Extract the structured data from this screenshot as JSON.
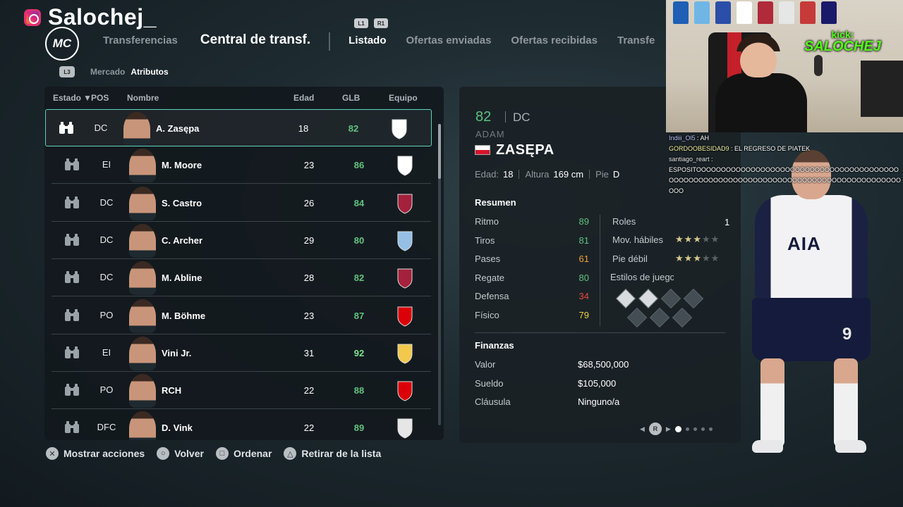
{
  "brand": {
    "name": "Salochej_"
  },
  "logo": {
    "text": "MC"
  },
  "nav": {
    "section": "Transferencias",
    "title": "Central de transf.",
    "bumper_left": "L1",
    "bumper_right": "R1",
    "tabs": [
      "Listado",
      "Ofertas enviadas",
      "Ofertas recibidas",
      "Transfe"
    ],
    "active_tab": "Listado"
  },
  "subnav": {
    "l3": "L3",
    "items": [
      "Mercado",
      "Atributos"
    ],
    "active": "Atributos"
  },
  "columns": {
    "estado": "Estado",
    "pos": "POS",
    "nombre": "Nombre",
    "edad": "Edad",
    "glb": "GLB",
    "equipo": "Equipo"
  },
  "players": [
    {
      "pos": "DC",
      "name": "A. Zasępa",
      "age": "18",
      "ovr": "82",
      "club": "Tottenham",
      "ovr_color": "#5fc27e",
      "club_color": "#ffffff"
    },
    {
      "pos": "EI",
      "name": "M. Moore",
      "age": "23",
      "ovr": "86",
      "club": "Tottenham",
      "ovr_color": "#5fc27e",
      "club_color": "#ffffff"
    },
    {
      "pos": "DC",
      "name": "S. Castro",
      "age": "26",
      "ovr": "84",
      "club": "Bologna",
      "ovr_color": "#5fc27e",
      "club_color": "#a3213b"
    },
    {
      "pos": "DC",
      "name": "C. Archer",
      "age": "29",
      "ovr": "80",
      "club": "Aston Villa",
      "ovr_color": "#5fc27e",
      "club_color": "#95bfe5"
    },
    {
      "pos": "DC",
      "name": "M. Abline",
      "age": "28",
      "ovr": "82",
      "club": "Bologna",
      "ovr_color": "#5fc27e",
      "club_color": "#a3213b"
    },
    {
      "pos": "PO",
      "name": "M. Böhme",
      "age": "23",
      "ovr": "87",
      "club": "Arsenal",
      "ovr_color": "#5fc27e",
      "club_color": "#db0007"
    },
    {
      "pos": "EI",
      "name": "Vini Jr.",
      "age": "31",
      "ovr": "92",
      "club": "Real Madrid",
      "ovr_color": "#7be58f",
      "club_color": "#f2c94c"
    },
    {
      "pos": "PO",
      "name": "RCH",
      "age": "22",
      "ovr": "88",
      "club": "Arsenal",
      "ovr_color": "#5fc27e",
      "club_color": "#db0007"
    },
    {
      "pos": "DFC",
      "name": "D. Vink",
      "age": "22",
      "ovr": "89",
      "club": "Newcastle",
      "ovr_color": "#5fc27e",
      "club_color": "#e6e6e6"
    }
  ],
  "actions": [
    {
      "btn": "✕",
      "label": "Mostrar acciones"
    },
    {
      "btn": "○",
      "label": "Volver"
    },
    {
      "btn": "□",
      "label": "Ordenar"
    },
    {
      "btn": "△",
      "label": "Retirar de la lista"
    }
  ],
  "detail": {
    "ovr": "82",
    "pos": "DC",
    "first_name": "ADAM",
    "last_name": "ZASĘPA",
    "age_label": "Edad:",
    "age": "18",
    "height_label": "Altura",
    "height": "169 cm",
    "foot_label": "Pie",
    "foot": "D",
    "summary_title": "Resumen",
    "stats": [
      {
        "label": "Ritmo",
        "value": "89",
        "color": "#5fc27e"
      },
      {
        "label": "Tiros",
        "value": "81",
        "color": "#5fc27e"
      },
      {
        "label": "Pases",
        "value": "61",
        "color": "#f0a233"
      },
      {
        "label": "Regate",
        "value": "80",
        "color": "#5fc27e"
      },
      {
        "label": "Defensa",
        "value": "34",
        "color": "#e5483d"
      },
      {
        "label": "Físico",
        "value": "79",
        "color": "#f0d23a"
      }
    ],
    "roles_label": "Roles",
    "roles_value": "1",
    "skill_moves_label": "Mov. hábiles",
    "skill_moves_stars": 3,
    "weak_foot_label": "Pie débil",
    "weak_foot_stars": 3,
    "playstyles_label": "Estilos de juego",
    "finance_title": "Finanzas",
    "value_label": "Valor",
    "value": "$68,500,000",
    "wage_label": "Sueldo",
    "wage": "$105,000",
    "clause_label": "Cláusula",
    "clause": "Ninguno/a",
    "pager_btn": "R",
    "colors": {
      "accent": "#5fd4bf"
    }
  },
  "stream": {
    "kick_small": "kick:",
    "kick_big": "SALOCHEJ",
    "chat": [
      {
        "user": "Indiii_Ol5",
        "msg": "AH"
      },
      {
        "user": "GORDOOBESIDAD9",
        "msg": "EL REGRESO DE PIATEK"
      },
      {
        "user": "santiago_reart",
        "msg": "ESPOSITOOOOOOOOOOOOOOOOOOOOOOOOOOOOOOOOOOOOOOOOOOOOOOOOOOOOOOOOOOOOOOOOOOOOOOOOOOOOOOOOOOOOOOOOOOO"
      }
    ]
  },
  "model": {
    "sponsor": "AIA",
    "number": "9"
  }
}
